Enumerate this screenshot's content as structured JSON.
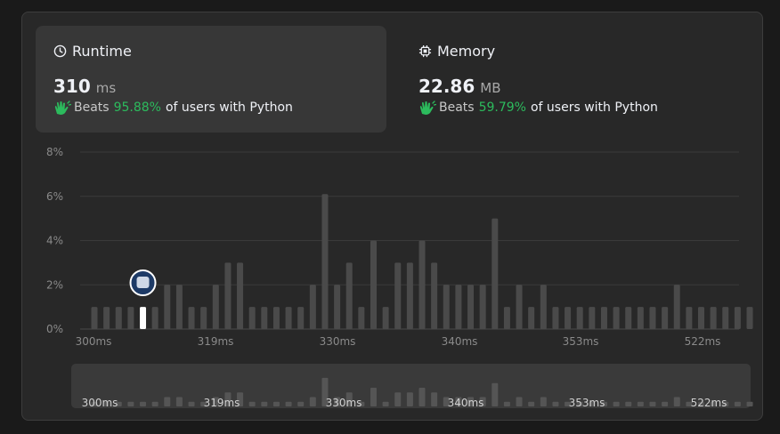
{
  "runtime": {
    "title": "Runtime",
    "value": "310",
    "unit": "ms",
    "beats_label": "Beats",
    "beats_pct": "95.88%",
    "beats_suffix": "of users with Python",
    "icon": "clock-icon"
  },
  "memory": {
    "title": "Memory",
    "value": "22.86",
    "unit": "MB",
    "beats_label": "Beats",
    "beats_pct": "59.79%",
    "beats_suffix": "of users with Python",
    "icon": "chip-icon"
  },
  "colors": {
    "accent_green": "#2cbb5d",
    "bar": "#4a4a4a",
    "bar_highlight": "#ffffff"
  },
  "chart_data": {
    "type": "bar",
    "yticks": [
      "8%",
      "6%",
      "4%",
      "2%",
      "0%"
    ],
    "ylim": [
      0,
      8
    ],
    "xtick_labels": [
      "300ms",
      "319ms",
      "330ms",
      "340ms",
      "353ms",
      "522ms"
    ],
    "values": [
      1,
      1,
      1,
      1,
      1,
      1,
      2,
      2,
      1,
      1,
      2,
      3,
      3,
      1,
      1,
      1,
      1,
      1,
      2,
      6.1,
      2,
      3,
      1,
      4,
      1,
      3,
      3,
      4,
      3,
      2,
      2,
      2,
      2,
      5,
      1,
      2,
      1,
      2,
      1,
      1,
      1,
      1,
      1,
      1,
      1,
      1,
      1,
      1,
      2,
      1,
      1,
      1,
      1,
      1,
      1
    ],
    "highlight_index": 4,
    "highlight_value": 1
  }
}
